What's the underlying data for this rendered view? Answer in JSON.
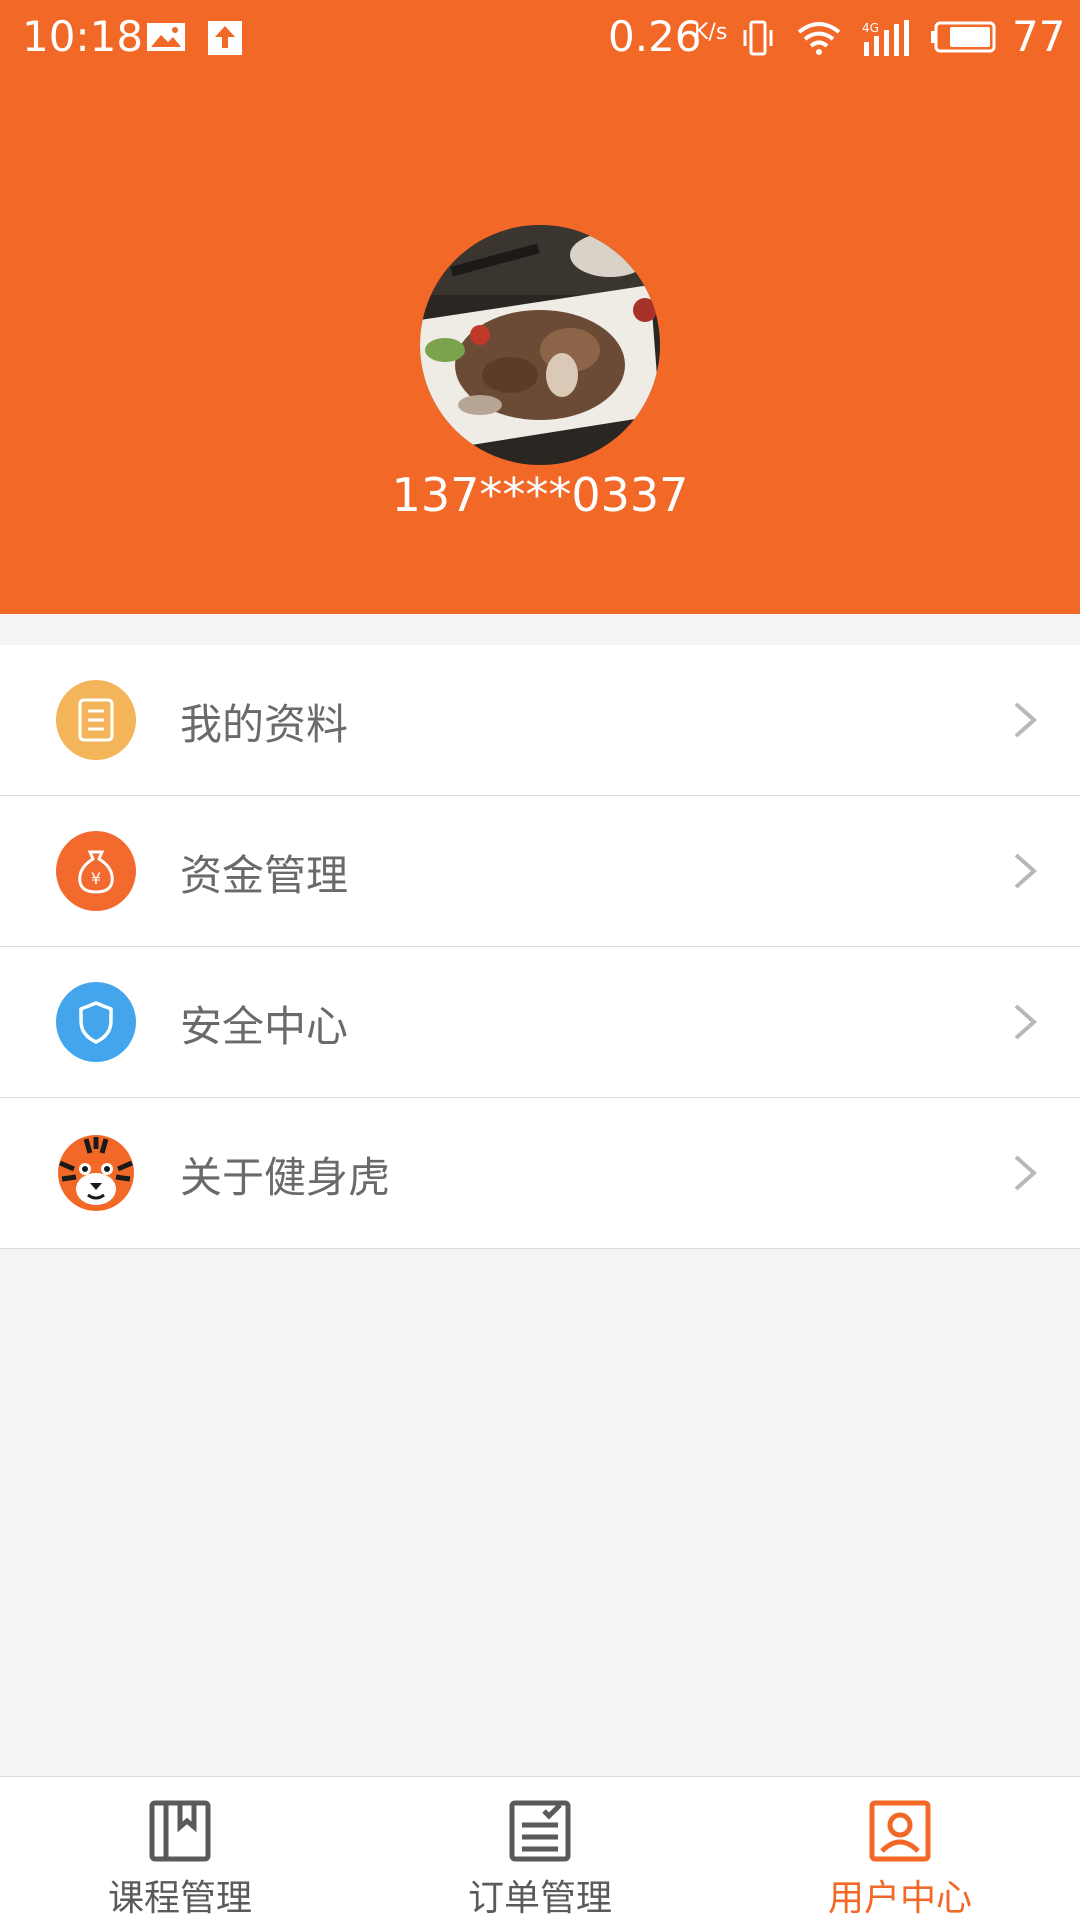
{
  "status_bar": {
    "time": "10:18",
    "speed": "0.26",
    "speed_unit": "K/s",
    "battery": "77"
  },
  "profile": {
    "username": "137****0337"
  },
  "menu": {
    "items": [
      {
        "label": "我的资料",
        "icon": "document-icon",
        "color": "#f4b459"
      },
      {
        "label": "资金管理",
        "icon": "money-bag-icon",
        "color": "#f26a2e"
      },
      {
        "label": "安全中心",
        "icon": "shield-icon",
        "color": "#43a6ec"
      },
      {
        "label": "关于健身虎",
        "icon": "tiger-logo-icon",
        "color": "#f26826"
      }
    ]
  },
  "tabbar": {
    "tabs": [
      {
        "label": "课程管理",
        "icon": "book-icon"
      },
      {
        "label": "订单管理",
        "icon": "order-list-icon"
      },
      {
        "label": "用户中心",
        "icon": "user-icon"
      }
    ],
    "active_index": 2,
    "active_color": "#f26826",
    "inactive_color": "#5a5a5a"
  },
  "colors": {
    "brand": "#f26826",
    "background": "#f4f4f4"
  }
}
